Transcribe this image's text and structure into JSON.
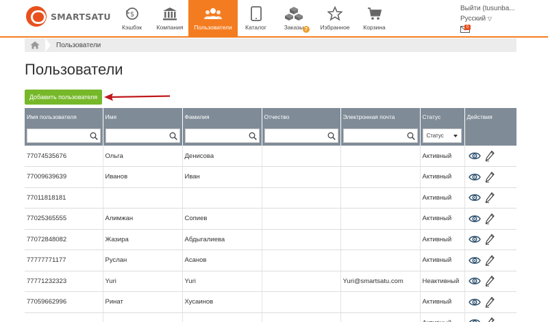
{
  "brand": {
    "name": "SMARTSATU",
    "accent": "#f47c20"
  },
  "nav": [
    {
      "label": "Кэшбэк",
      "icon": "cashback-icon",
      "active": false
    },
    {
      "label": "Компания",
      "icon": "bank-icon",
      "active": false
    },
    {
      "label": "Пользователи",
      "icon": "users-icon",
      "active": true
    },
    {
      "label": "Каталог",
      "icon": "tablet-icon",
      "active": false
    },
    {
      "label": "Заказы",
      "icon": "boxes-icon",
      "active": false,
      "badge": "7"
    },
    {
      "label": "Избранное",
      "icon": "star-icon",
      "active": false
    },
    {
      "label": "Корзина",
      "icon": "cart-icon",
      "active": false
    }
  ],
  "user": {
    "logout": "Выйти (tusunba...",
    "language": "Русский",
    "mail_count": "0"
  },
  "breadcrumb": {
    "current": "Пользователи"
  },
  "page": {
    "title": "Пользователи",
    "add_button": "Добавить пользователя"
  },
  "table": {
    "columns": [
      "Имя пользователя",
      "Имя",
      "Фамилия",
      "Отчество",
      "Электронная почта",
      "Статус",
      "Действия"
    ],
    "status_filter": "Статус",
    "rows": [
      {
        "username": "77074535676",
        "first": "Ольга",
        "last": "Денисова",
        "middle": "",
        "email": "",
        "status": "Активный"
      },
      {
        "username": "77009639639",
        "first": "Иванов",
        "last": "Иван",
        "middle": "",
        "email": "",
        "status": "Активный"
      },
      {
        "username": "77011818181",
        "first": "",
        "last": "",
        "middle": "",
        "email": "",
        "status": "Активный"
      },
      {
        "username": "77025365555",
        "first": "Алимжан",
        "last": "Сопиев",
        "middle": "",
        "email": "",
        "status": "Активный"
      },
      {
        "username": "77072848082",
        "first": "Жазира",
        "last": "Абдыгалиева",
        "middle": "",
        "email": "",
        "status": "Активный"
      },
      {
        "username": "77777771177",
        "first": "Руслан",
        "last": "Асанов",
        "middle": "",
        "email": "",
        "status": "Активный"
      },
      {
        "username": "77771232323",
        "first": "Yuri",
        "last": "Yuri",
        "middle": "",
        "email": "Yuri@smartsatu.com",
        "status": "Неактивный"
      },
      {
        "username": "77059662996",
        "first": "Ринат",
        "last": "Хусаинов",
        "middle": "",
        "email": "",
        "status": "Активный"
      },
      {
        "username": "",
        "first": "",
        "last": "",
        "middle": "",
        "email": "",
        "status": "Активный"
      }
    ]
  }
}
